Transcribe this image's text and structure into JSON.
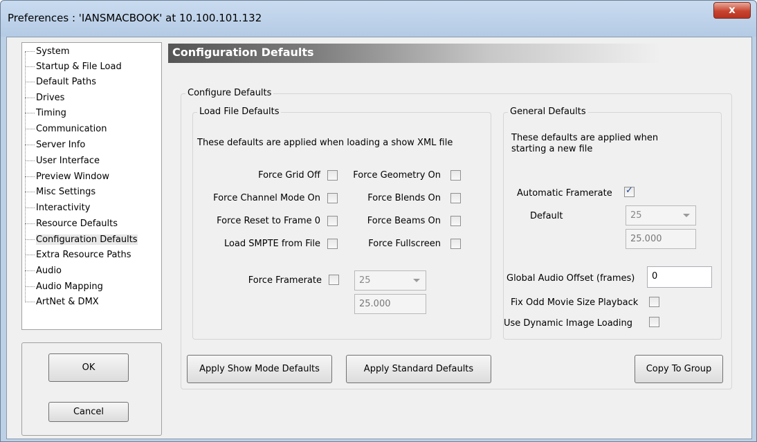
{
  "window": {
    "title": "Preferences  :  'IANSMACBOOK' at 10.100.101.132",
    "close_label": "x"
  },
  "tree": {
    "items": [
      "System",
      "Startup & File Load",
      "Default Paths",
      "Drives",
      "Timing",
      "Communication",
      "Server Info",
      "User Interface",
      "Preview Window",
      "Misc Settings",
      "Interactivity",
      "Resource Defaults",
      "Configuration Defaults",
      "Extra Resource Paths",
      "Audio",
      "Audio Mapping",
      "ArtNet & DMX"
    ],
    "selected": "Configuration Defaults"
  },
  "buttons": {
    "ok": "OK",
    "cancel": "Cancel"
  },
  "header": {
    "title": "Configuration Defaults"
  },
  "configure": {
    "title": "Configure Defaults",
    "load_file": {
      "title": "Load File Defaults",
      "description": "These defaults are applied when loading a show XML file",
      "force_grid_off": "Force Grid Off",
      "force_geometry_on": "Force Geometry On",
      "force_channel_mode_on": "Force Channel Mode On",
      "force_blends_on": "Force Blends On",
      "force_reset_to_frame_0": "Force Reset to Frame 0",
      "force_beams_on": "Force Beams On",
      "load_smpte_from_file": "Load SMPTE from File",
      "force_fullscreen": "Force Fullscreen",
      "force_framerate": "Force Framerate",
      "framerate_value": "25",
      "framerate_exact": "25.000"
    },
    "general": {
      "title": "General Defaults",
      "description_line1": "These defaults are applied when",
      "description_line2": "starting a new file",
      "automatic_framerate": "Automatic Framerate",
      "default_label": "Default",
      "default_value": "25",
      "default_exact": "25.000",
      "global_audio_offset": "Global Audio Offset (frames)",
      "global_audio_offset_value": "0",
      "fix_odd_movie_size": "Fix Odd Movie Size Playback",
      "use_dynamic_image_loading": "Use Dynamic Image Loading"
    },
    "apply_show_mode": "Apply Show Mode Defaults",
    "apply_standard": "Apply Standard Defaults",
    "copy_to_group": "Copy To Group"
  }
}
